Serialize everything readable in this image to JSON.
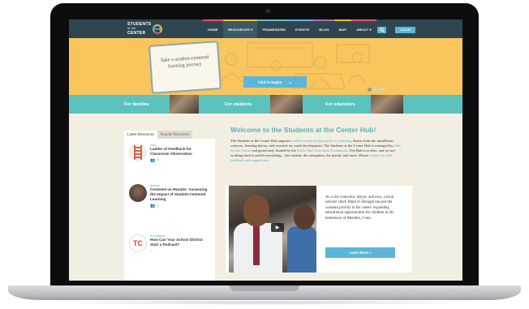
{
  "nav": {
    "logo_line1": "STUDENTS",
    "logo_line2": "at the",
    "logo_line3": "CENTER",
    "logo_badge": "HUB",
    "items": [
      {
        "label": "HOME"
      },
      {
        "label": "RESOURCES ▾"
      },
      {
        "label": "FRAMEWORK"
      },
      {
        "label": "EVENTS"
      },
      {
        "label": "BLOG"
      },
      {
        "label": "MAP"
      },
      {
        "label": "ABOUT ▾"
      }
    ],
    "search_icon": "search-icon",
    "login_label": "LOG IN"
  },
  "hero": {
    "tablet_text": "Take a student-centered learning journey",
    "cta_label": "Click to begin!",
    "cta_icon": "chevron-down-icon",
    "slide_count": 3
  },
  "audience": {
    "families": "For families",
    "students": "For students",
    "educators": "For educators"
  },
  "resources": {
    "tab_latest": "Latest Resources",
    "tab_popular": "Popular Resources",
    "items": [
      {
        "type": "TOOL",
        "title": "Ladder of Feedback for Classroom Observation"
      },
      {
        "type": "REPORT",
        "title": "Centered on Results: Assessing the Impact of Student-Centered Learning"
      },
      {
        "type": "MULTIMEDIA",
        "title": "How Can Your School District Start a Podcast?"
      }
    ]
  },
  "main": {
    "welcome": "Welcome to the Students at the Center Hub!",
    "intro_1": "The Students at the Center Hub supports ",
    "intro_link_1": "student-centered approaches to learning",
    "intro_2": ", drawn from the mind/brain sciences, learning theory, and research on youth development. The Students at the Center Hub is managed by ",
    "intro_link_2": "Jobs for the Future",
    "intro_3": " and generously funded by the ",
    "intro_link_3": "Nellie Mae Education Foundation",
    "intro_4": ". The Hub is in beta, and we are working hard to polish everything – the content, the navigation, the layout, and more. Please ",
    "intro_link_4": "contact us with feedback and suggestions",
    "intro_5": ".",
    "feature_text": "As a city councilor, mayor, and now, a local schools chief, Mark D. Benigni has put the constant priority in his career: expanding educational opportunities for children in his hometown of Meriden, Conn.",
    "learn_more": "Learn More »"
  },
  "colors": {
    "nav_bg": "#2f4650",
    "hero_bg": "#f8c65d",
    "teal": "#5bc2bd",
    "button_blue": "#5bb6d8"
  }
}
